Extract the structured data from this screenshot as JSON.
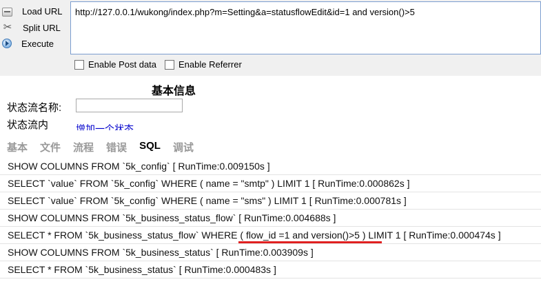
{
  "toolbar": {
    "load_url": "Load URL",
    "split_url": "Split URL",
    "execute": "Execute",
    "url_value": "http://127.0.0.1/wukong/index.php?m=Setting&a=statusflowEdit&id=1 and version()>5",
    "enable_post": "Enable Post data",
    "enable_referrer": "Enable Referrer"
  },
  "page": {
    "heading": "基本信息",
    "name_label": "状态流名称:",
    "content_label": "状态流内",
    "add_status_link": "增加一个状态"
  },
  "trace_tabs": [
    "基本",
    "文件",
    "流程",
    "错误",
    "SQL",
    "调试"
  ],
  "active_tab": "SQL",
  "sql": [
    "SHOW COLUMNS FROM `5k_config` [ RunTime:0.009150s ]",
    "SELECT `value` FROM `5k_config` WHERE ( name = \"smtp\" ) LIMIT 1 [ RunTime:0.000862s ]",
    "SELECT `value` FROM `5k_config` WHERE ( name = \"sms\" ) LIMIT 1 [ RunTime:0.000781s ]",
    "SHOW COLUMNS FROM `5k_business_status_flow` [ RunTime:0.004688s ]",
    "SELECT * FROM `5k_business_status_flow` WHERE ( flow_id =1 and version()>5 ) LIMIT 1 [ RunTime:0.000474s ]",
    "SHOW COLUMNS FROM `5k_business_status` [ RunTime:0.003909s ]",
    "SELECT * FROM `5k_business_status` [ RunTime:0.000483s ]"
  ],
  "colors": {
    "highlight_underline": "#e02020",
    "link": "#0000cc"
  }
}
